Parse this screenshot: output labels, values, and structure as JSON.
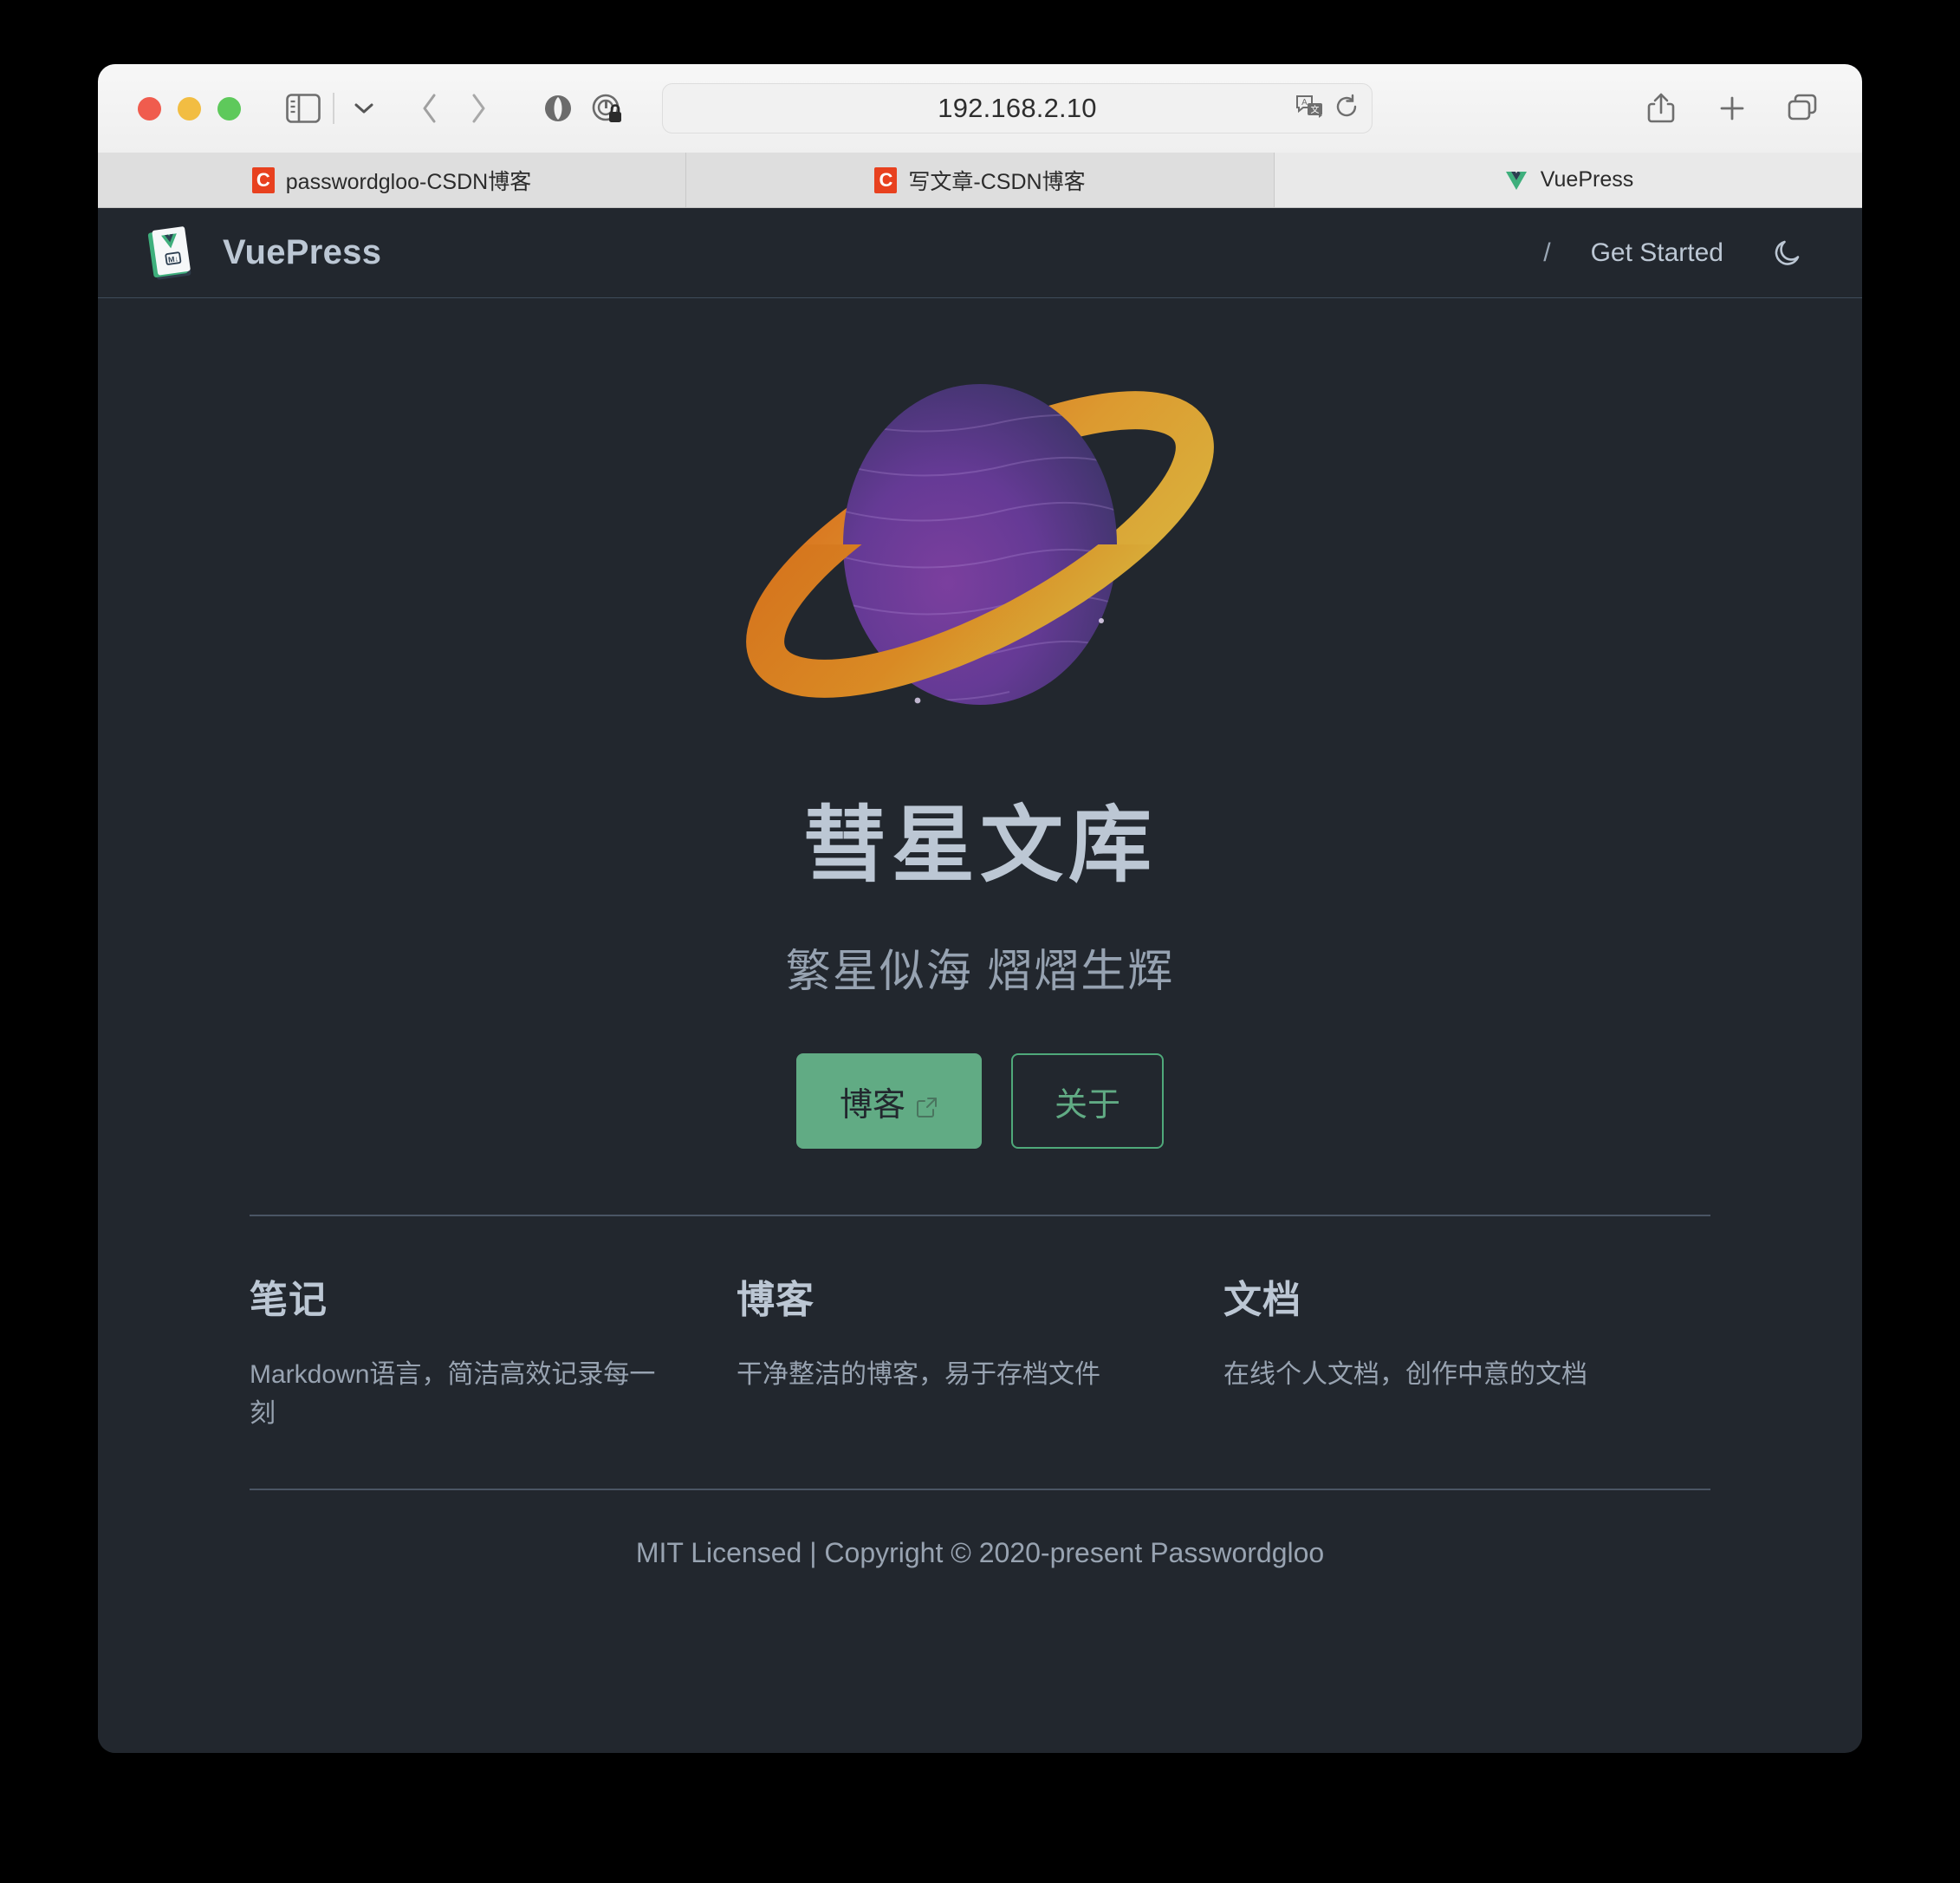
{
  "browser": {
    "address": {
      "url": "192.168.2.10",
      "placeholder": "Search or enter website name"
    },
    "icons": {
      "sidebar": "sidebar-icon",
      "sidebar_dropdown": "chevron-down-icon",
      "back": "back-chevron-icon",
      "forward": "forward-chevron-icon",
      "extension_shield": "extension-icon",
      "privacy_report": "privacy-lock-icon",
      "translate": "translate-icon",
      "reload": "reload-icon",
      "share": "share-icon",
      "new_tab": "plus-icon",
      "tab_overview": "tab-overview-icon"
    },
    "tabs": [
      {
        "title": "passwordgloo-CSDN博客",
        "favicon": "csdn-favicon",
        "favicon_letter": "C",
        "active": false
      },
      {
        "title": "写文章-CSDN博客",
        "favicon": "csdn-favicon",
        "favicon_letter": "C",
        "active": false
      },
      {
        "title": "VuePress",
        "favicon": "vuepress-favicon",
        "favicon_letter": "",
        "active": true
      }
    ]
  },
  "site": {
    "navbar": {
      "brand": "VuePress",
      "brand_logo": "vuepress-logo-icon",
      "links": [
        {
          "label": "/"
        },
        {
          "label": "Get Started"
        }
      ],
      "theme_toggle": "moon-icon"
    },
    "hero": {
      "image_alt": "saturn-planet-illustration",
      "title": "彗星文库",
      "tagline": "繁星似海 熠熠生辉",
      "actions": [
        {
          "label": "博客",
          "style": "primary",
          "external": true,
          "external_icon": "external-link-icon"
        },
        {
          "label": "关于",
          "style": "secondary",
          "external": false
        }
      ]
    },
    "features": [
      {
        "title": "笔记",
        "details": "Markdown语言，简洁高效记录每一刻"
      },
      {
        "title": "博客",
        "details": "干净整洁的博客，易于存档文件"
      },
      {
        "title": "文档",
        "details": "在线个人文档，创作中意的文档"
      }
    ],
    "footer": "MIT Licensed | Copyright © 2020-present Passwordgloo"
  },
  "colors": {
    "page_bg": "#22272e",
    "text_primary": "#bcc7d4",
    "text_secondary": "#98a3b1",
    "accent_green": "#61ab84",
    "divider": "#4a5564",
    "planet_body": "#6a3f9c",
    "planet_ring": "#d98326"
  }
}
